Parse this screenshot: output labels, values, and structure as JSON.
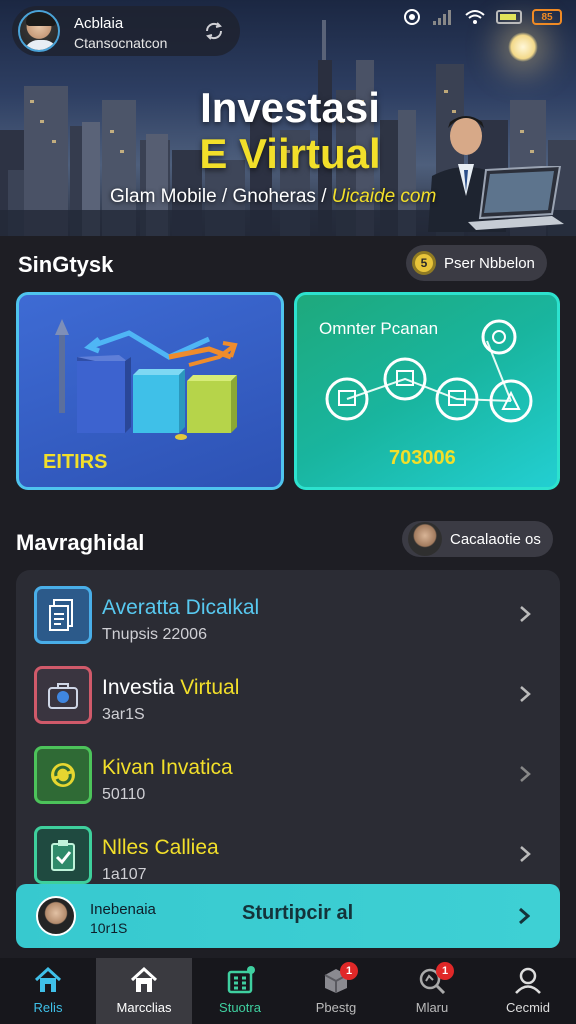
{
  "header": {
    "user_name": "Acblaia",
    "user_sub": "Ctansocnatcon"
  },
  "hero": {
    "title_line1": "Investasi",
    "title_line2": "E Viirtual",
    "subtitle_main": "Glam Mobile / Gnoheras /",
    "subtitle_highlight": "Uicaide com"
  },
  "section1": {
    "title": "SinGtysk",
    "pill_coin": "5",
    "pill_label": "Pser Nbbelon"
  },
  "cards": [
    {
      "label": "EITIRS"
    },
    {
      "title": "Omnter Pcanan",
      "value": "703006"
    }
  ],
  "section2": {
    "title": "Mavraghidal",
    "pill_label": "Cacalaotie os"
  },
  "list": [
    {
      "title": "Averatta Dicalkal",
      "title_highlight": "",
      "sub": "Tnupsis 22006",
      "color": "#58c9f0"
    },
    {
      "title": "Investia",
      "title_highlight": "Virtual",
      "sub": "3ar1S",
      "color": "#ffffff"
    },
    {
      "title": "Kivan Invatica",
      "title_highlight": "",
      "sub": "50110",
      "color": "#f2df2a"
    },
    {
      "title": "Nlles Calliea",
      "title_highlight": "",
      "sub": "1a107",
      "color": "#f2df2a"
    }
  ],
  "promo": {
    "name": "Inebenaia",
    "sub": "10r1S",
    "action": "Sturtipcir al"
  },
  "nav": [
    {
      "label": "Relis",
      "icon": "home-icon",
      "color": "#3fc0e8"
    },
    {
      "label": "Marcclias",
      "icon": "house-icon",
      "color": "#ffffff"
    },
    {
      "label": "Stuotra",
      "icon": "grid-icon",
      "color": "#3fd0a0"
    },
    {
      "label": "Pbestg",
      "icon": "box-icon",
      "color": "#bbbbbb",
      "badge": "1"
    },
    {
      "label": "Mlaru",
      "icon": "search-icon",
      "color": "#bbbbbb",
      "badge": "1"
    },
    {
      "label": "Cecmid",
      "icon": "user-icon",
      "color": "#dddddd"
    }
  ],
  "colors": {
    "accent_yellow": "#f2df2a",
    "accent_cyan": "#3fc0e8",
    "panel": "#2b2c34",
    "background": "#1e1e24"
  }
}
